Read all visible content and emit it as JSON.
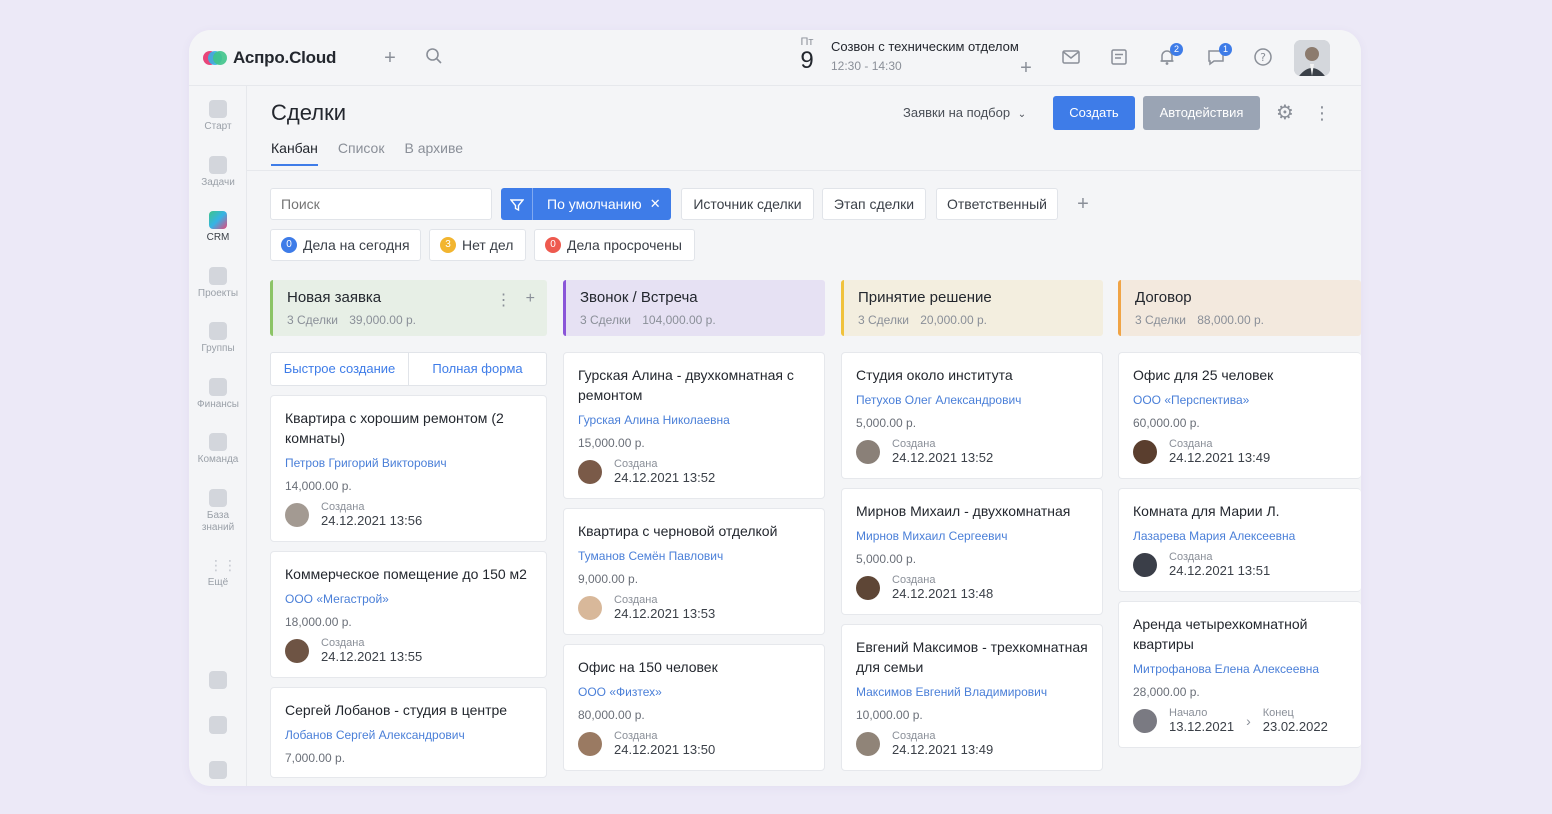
{
  "app": {
    "logo": "Аспро.Cloud"
  },
  "topbar": {
    "date_dow": "Пт",
    "date_day": "9",
    "event_title": "Созвон с техническим отделом",
    "event_time": "12:30 - 14:30",
    "bell_badge": "2",
    "chat_badge": "1"
  },
  "sidebar": [
    {
      "label": "Старт",
      "icon": "heart-icon"
    },
    {
      "label": "Задачи",
      "icon": "check-icon"
    },
    {
      "label": "CRM",
      "icon": "funnel-icon"
    },
    {
      "label": "Проекты",
      "icon": "projects-icon"
    },
    {
      "label": "Группы",
      "icon": "groups-icon"
    },
    {
      "label": "Финансы",
      "icon": "finance-icon"
    },
    {
      "label": "Команда",
      "icon": "team-icon"
    },
    {
      "label": "База знаний",
      "icon": "knowledge-icon"
    },
    {
      "label": "Ещё",
      "icon": "grid-icon"
    }
  ],
  "page": {
    "title": "Сделки",
    "tabs": [
      "Канбан",
      "Список",
      "В архиве"
    ],
    "select": "Заявки на подбор",
    "create_label": "Создать",
    "auto_label": "Автодействия"
  },
  "filters": {
    "search_placeholder": "Поиск",
    "active_filter": "По умолчанию",
    "chips": [
      "Источник сделки",
      "Этап сделки",
      "Ответственный"
    ],
    "quick": [
      {
        "count": "0",
        "label": "Дела на сегодня",
        "color": "#3e7ce8"
      },
      {
        "count": "3",
        "label": "Нет дел",
        "color": "#f2b530"
      },
      {
        "count": "0",
        "label": "Дела просрочены",
        "color": "#ee5a4f"
      }
    ]
  },
  "columns": [
    {
      "title": "Новая заявка",
      "count": "3 Сделки",
      "sum": "39,000.00 р.",
      "bg": "#e7efe6",
      "accent": "#8cc466",
      "quick_create": "Быстрое создание",
      "full_form": "Полная форма",
      "cards": [
        {
          "title": "Квартира с хорошим ремонтом (2 комнаты)",
          "person": "Петров Григорий Викторович",
          "amount": "14,000.00 р.",
          "meta_label": "Создана",
          "meta_value": "24.12.2021 13:56"
        },
        {
          "title": "Коммерческое помещение до 150 м2",
          "person": "ООО «Мегастрой»",
          "amount": "18,000.00 р.",
          "meta_label": "Создана",
          "meta_value": "24.12.2021 13:55"
        },
        {
          "title": "Сергей Лобанов - студия в центре",
          "person": "Лобанов Сергей Александрович",
          "amount": "7,000.00 р.",
          "meta_label": "",
          "meta_value": ""
        }
      ]
    },
    {
      "title": "Звонок / Встреча",
      "count": "3 Сделки",
      "sum": "104,000.00 р.",
      "bg": "#e6e1f3",
      "accent": "#8a55d8",
      "cards": [
        {
          "title": "Гурская Алина - двухкомнатная с ремонтом",
          "person": "Гурская Алина Николаевна",
          "amount": "15,000.00 р.",
          "meta_label": "Создана",
          "meta_value": "24.12.2021 13:52"
        },
        {
          "title": "Квартира с черновой отделкой",
          "person": "Туманов Семён Павлович",
          "amount": "9,000.00 р.",
          "meta_label": "Создана",
          "meta_value": "24.12.2021 13:53"
        },
        {
          "title": "Офис на 150 человек",
          "person": "ООО «Физтех»",
          "amount": "80,000.00 р.",
          "meta_label": "Создана",
          "meta_value": "24.12.2021 13:50"
        }
      ]
    },
    {
      "title": "Принятие решение",
      "count": "3 Сделки",
      "sum": "20,000.00 р.",
      "bg": "#f3eedf",
      "accent": "#f0c23c",
      "cards": [
        {
          "title": "Студия около института",
          "person": "Петухов Олег Александрович",
          "amount": "5,000.00 р.",
          "meta_label": "Создана",
          "meta_value": "24.12.2021 13:52"
        },
        {
          "title": "Мирнов Михаил - двухкомнатная",
          "person": "Мирнов Михаил Сергеевич",
          "amount": "5,000.00 р.",
          "meta_label": "Создана",
          "meta_value": "24.12.2021 13:48"
        },
        {
          "title": "Евгений Максимов - трехкомнатная для семьи",
          "person": "Максимов Евгений Владимирович",
          "amount": "10,000.00 р.",
          "meta_label": "Создана",
          "meta_value": "24.12.2021 13:49"
        }
      ]
    },
    {
      "title": "Договор",
      "count": "3 Сделки",
      "sum": "88,000.00 р.",
      "bg": "#f3e9de",
      "accent": "#f0a446",
      "cards": [
        {
          "title": "Офис для 25 человек",
          "person": "ООО «Перспектива»",
          "amount": "60,000.00 р.",
          "meta_label": "Создана",
          "meta_value": "24.12.2021 13:49"
        },
        {
          "title": "Комната для Марии Л.",
          "person": "Лазарева Мария Алексеевна",
          "amount": "",
          "meta_label": "Создана",
          "meta_value": "24.12.2021 13:51"
        },
        {
          "title": "Аренда четырехкомнатной квартиры",
          "person": "Митрофанова Елена Алексеевна",
          "amount": "28,000.00 р.",
          "meta_label": "Начало",
          "meta_value": "13.12.2021",
          "meta2_label": "Конец",
          "meta2_value": "23.02.2022"
        }
      ]
    }
  ]
}
